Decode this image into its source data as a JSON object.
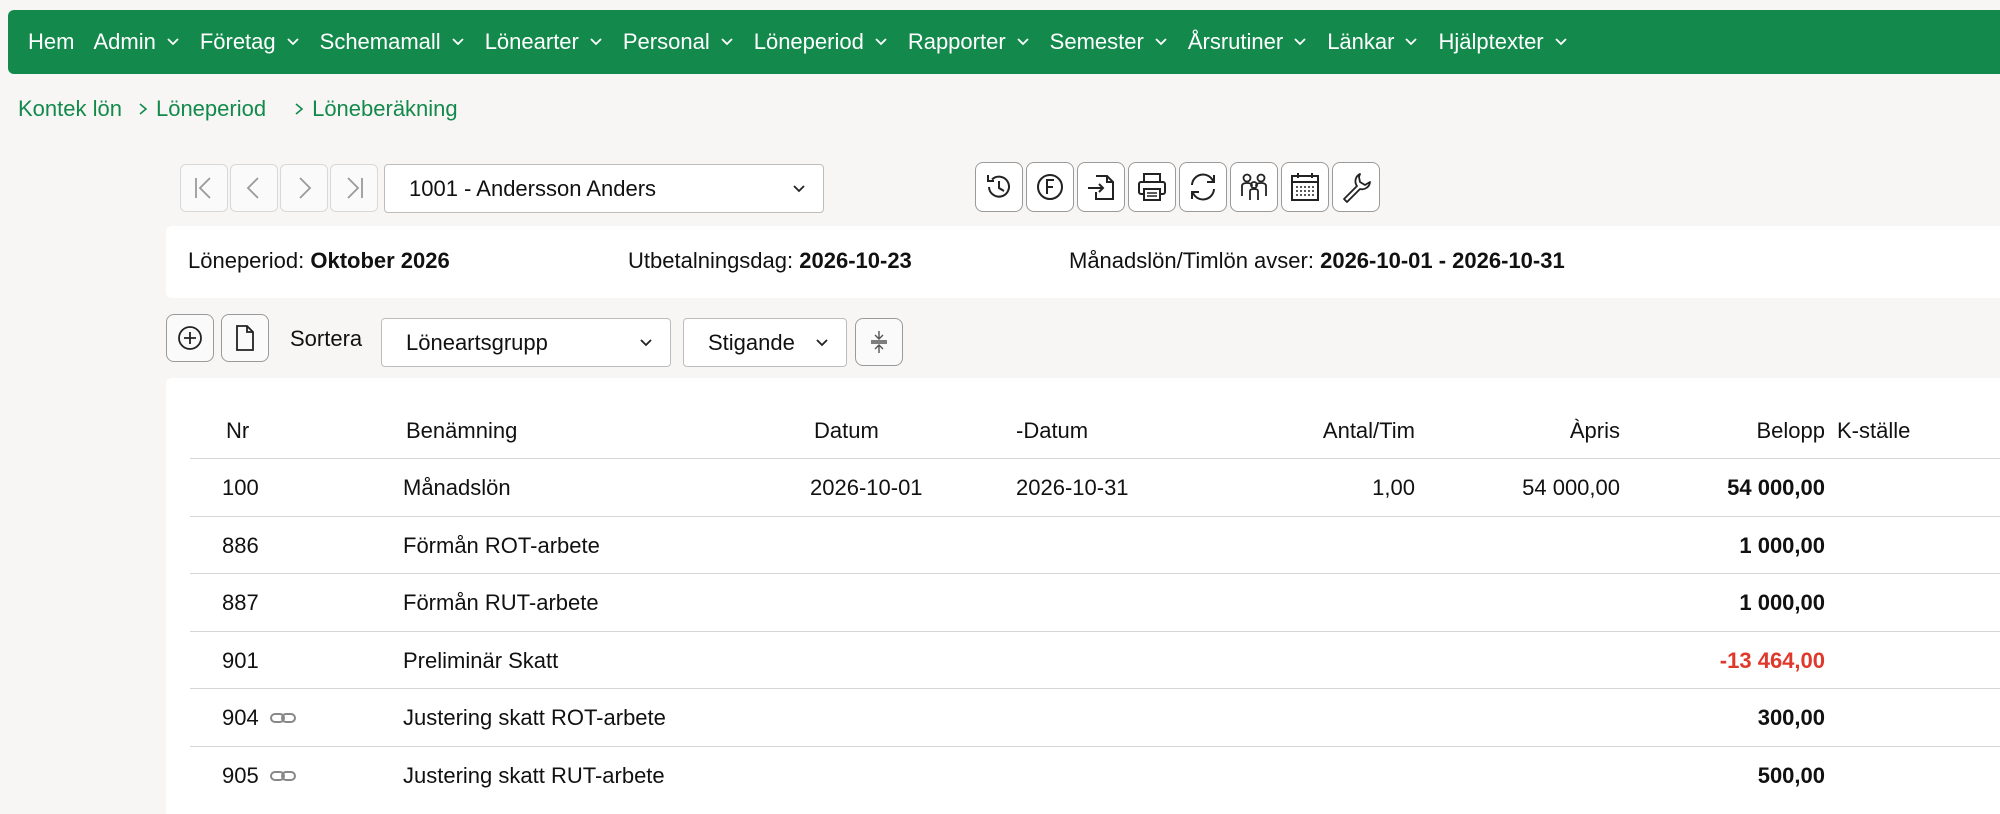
{
  "nav": {
    "items": [
      {
        "label": "Hem",
        "dropdown": false
      },
      {
        "label": "Admin",
        "dropdown": true
      },
      {
        "label": "Företag",
        "dropdown": true
      },
      {
        "label": "Schemamall",
        "dropdown": true
      },
      {
        "label": "Lönearter",
        "dropdown": true
      },
      {
        "label": "Personal",
        "dropdown": true
      },
      {
        "label": "Löneperiod",
        "dropdown": true
      },
      {
        "label": "Rapporter",
        "dropdown": true
      },
      {
        "label": "Semester",
        "dropdown": true
      },
      {
        "label": "Årsrutiner",
        "dropdown": true
      },
      {
        "label": "Länkar",
        "dropdown": true
      },
      {
        "label": "Hjälptexter",
        "dropdown": true
      }
    ]
  },
  "breadcrumb": [
    "Kontek lön",
    "Löneperiod",
    "Löneberäkning"
  ],
  "employee": {
    "selected": "1001 - Andersson Anders"
  },
  "toolbar_icons": [
    "history-icon",
    "f-circle-icon",
    "import-icon",
    "print-icon",
    "refresh-icon",
    "group-icon",
    "calendar-icon",
    "wrench-icon"
  ],
  "period": {
    "loneperiod_label": "Löneperiod:",
    "loneperiod_value": "Oktober 2026",
    "utbetalning_label": "Utbetalningsdag:",
    "utbetalning_value": "2026-10-23",
    "avser_label": "Månadslön/Timlön avser:",
    "avser_value": "2026-10-01 - 2026-10-31"
  },
  "sort": {
    "label": "Sortera",
    "field": "Löneartsgrupp",
    "order": "Stigande"
  },
  "table": {
    "headers": {
      "nr": "Nr",
      "benamning": "Benämning",
      "datum": "Datum",
      "tom_datum": "-Datum",
      "antal": "Antal/Tim",
      "apris": "Àpris",
      "belopp": "Belopp",
      "kstalle": "K-ställe"
    },
    "rows": [
      {
        "nr": "100",
        "benamning": "Månadslön",
        "datum": "2026-10-01",
        "tom_datum": "2026-10-31",
        "antal": "1,00",
        "apris": "54 000,00",
        "belopp": "54 000,00",
        "negative": false,
        "linked": false
      },
      {
        "nr": "886",
        "benamning": "Förmån ROT-arbete",
        "datum": "",
        "tom_datum": "",
        "antal": "",
        "apris": "",
        "belopp": "1 000,00",
        "negative": false,
        "linked": false
      },
      {
        "nr": "887",
        "benamning": "Förmån RUT-arbete",
        "datum": "",
        "tom_datum": "",
        "antal": "",
        "apris": "",
        "belopp": "1 000,00",
        "negative": false,
        "linked": false
      },
      {
        "nr": "901",
        "benamning": "Preliminär Skatt",
        "datum": "",
        "tom_datum": "",
        "antal": "",
        "apris": "",
        "belopp": "-13 464,00",
        "negative": true,
        "linked": false
      },
      {
        "nr": "904",
        "benamning": "Justering skatt ROT-arbete",
        "datum": "",
        "tom_datum": "",
        "antal": "",
        "apris": "",
        "belopp": "300,00",
        "negative": false,
        "linked": true
      },
      {
        "nr": "905",
        "benamning": "Justering skatt RUT-arbete",
        "datum": "",
        "tom_datum": "",
        "antal": "",
        "apris": "",
        "belopp": "500,00",
        "negative": false,
        "linked": true
      }
    ]
  },
  "colors": {
    "brand": "#138a4c",
    "negative": "#e0392b"
  }
}
